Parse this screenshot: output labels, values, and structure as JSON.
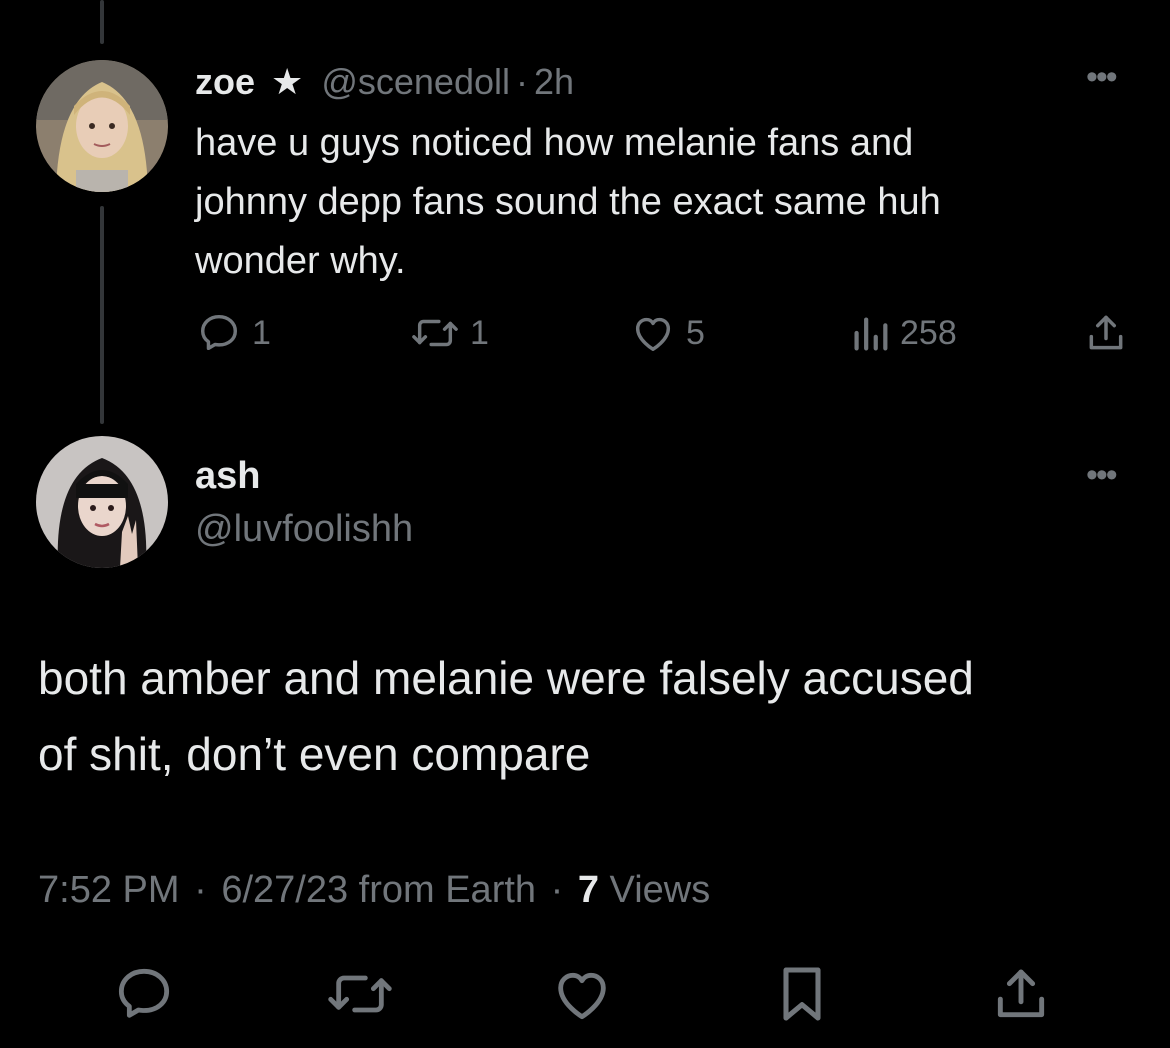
{
  "parent_tweet": {
    "display_name": "zoe",
    "badge": "★",
    "handle": "@scenedoll",
    "separator": "·",
    "age": "2h",
    "text_lines": [
      "have u guys noticed how melanie fans and",
      "johnny depp fans sound the exact same huh",
      "wonder why."
    ],
    "actions": {
      "replies": "1",
      "reposts": "1",
      "likes": "5",
      "views": "258"
    },
    "avatar_icon": "user-photo-zoe",
    "more_icon": "more-dots-icon"
  },
  "reply_tweet": {
    "display_name": "ash",
    "handle": "@luvfoolishh",
    "text_lines": [
      "both amber and melanie were falsely accused",
      "of shit, don’t even compare"
    ],
    "meta": {
      "time": "7:52 PM",
      "sep1": "·",
      "date_source": "6/27/23 from Earth",
      "sep2": "·",
      "views_count": "7",
      "views_label": "Views"
    },
    "avatar_icon": "user-photo-ash",
    "more_icon": "more-dots-icon"
  },
  "bottom_bar": {
    "icons": [
      "reply-icon",
      "repost-icon",
      "like-icon",
      "bookmark-icon",
      "share-icon"
    ]
  },
  "colors": {
    "background": "#000000",
    "text": "#e7e9ea",
    "muted": "#71767b",
    "thread_line": "#333639"
  }
}
